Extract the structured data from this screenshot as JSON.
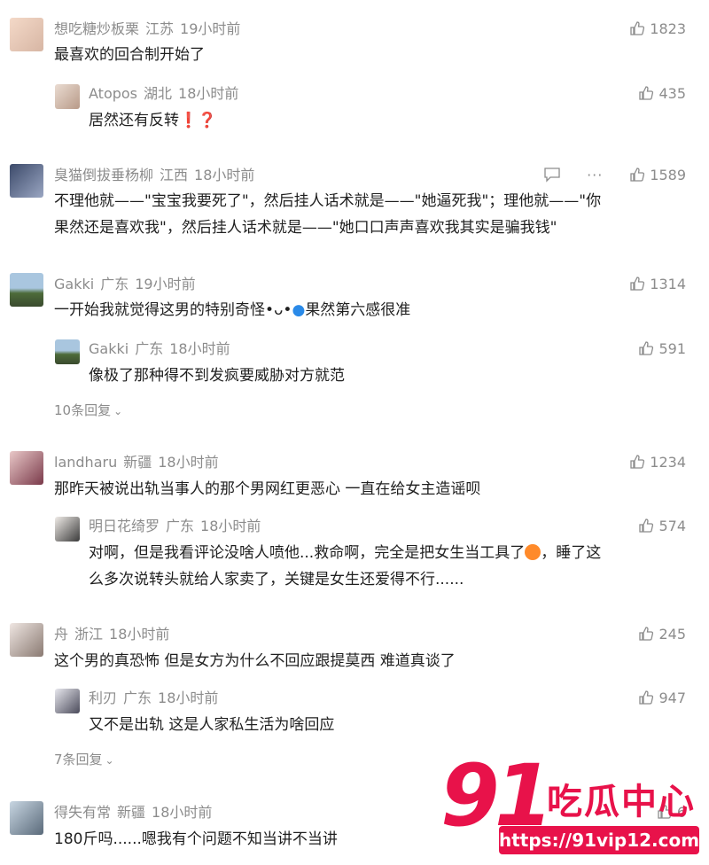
{
  "comments": [
    {
      "user": "想吃糖炒板栗",
      "location": "江苏",
      "time": "19小时前",
      "likes": "1823",
      "text": "最喜欢的回合制开始了",
      "reply": {
        "user": "Atopos",
        "location": "湖北",
        "time": "18小时前",
        "likes": "435",
        "text": "居然还有反转",
        "suffix": "❗❓"
      }
    },
    {
      "user": "臭猫倒拔垂杨柳",
      "location": "江西",
      "time": "18小时前",
      "likes": "1589",
      "text_line1": "不理他就——\"宝宝我要死了\"，然后挂人话术就是——\"她逼死我\"；理他就——\"你",
      "text_line2": "果然还是喜欢我\"，然后挂人话术就是——\"她口口声声喜欢我其实是骗我钱\""
    },
    {
      "user": "Gakki",
      "location": "广东",
      "time": "19小时前",
      "likes": "1314",
      "text": "一开始我就觉得这男的特别奇怪•ᴗ•",
      "text_tail": "果然第六感很准",
      "reply": {
        "user": "Gakki",
        "location": "广东",
        "time": "18小时前",
        "likes": "591",
        "text": "像极了那种得不到发疯要威胁对方就范"
      },
      "more": "10条回复"
    },
    {
      "user": "landharu",
      "location": "新疆",
      "time": "18小时前",
      "likes": "1234",
      "text": "那昨天被说出轨当事人的那个男网红更恶心 一直在给女主造谣呗",
      "reply": {
        "user": "明日花绮罗",
        "location": "广东",
        "time": "18小时前",
        "likes": "574",
        "text_line1a": "对啊，但是我看评论没啥人喷他...救命啊，完全是把女生当工具了",
        "text_line1b": "，睡了这",
        "text_line2": "么多次说转头就给人家卖了，关键是女生还爱得不行......"
      }
    },
    {
      "user": "舟",
      "location": "浙江",
      "time": "18小时前",
      "likes": "245",
      "text": "这个男的真恐怖 但是女方为什么不回应跟提莫西 难道真谈了",
      "reply": {
        "user": "利刃",
        "location": "广东",
        "time": "18小时前",
        "likes": "947",
        "text": "又不是出轨 这是人家私生活为啥回应"
      },
      "more": "7条回复"
    },
    {
      "user": "得失有常",
      "location": "新疆",
      "time": "18小时前",
      "likes": "6",
      "text": "180斤吗......嗯我有个问题不知当讲不当讲"
    }
  ],
  "more_chevron": "⌄",
  "tool_more": "···",
  "watermark": {
    "number": "91",
    "name": "吃瓜中心",
    "url": "https://91vip12.com"
  },
  "colors": {
    "meta": "#8c8c8c",
    "text": "#1f1f1f",
    "watermark": "#e8124a"
  },
  "icons": [
    "like-icon",
    "reply-icon",
    "more-icon",
    "chevron-down-icon"
  ]
}
